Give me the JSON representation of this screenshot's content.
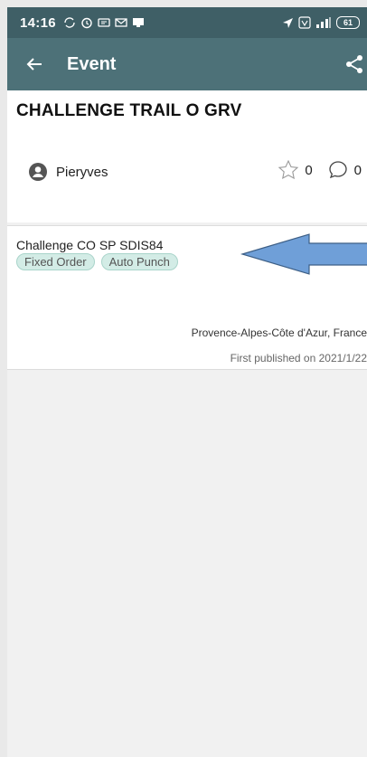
{
  "status": {
    "time": "14:16",
    "battery": "61"
  },
  "appbar": {
    "title": "Event"
  },
  "event": {
    "title": "CHALLENGE TRAIL O GRV",
    "author": "Pieryves",
    "likes": "0",
    "comments": "0"
  },
  "course": {
    "name": "Challenge CO SP SDIS84",
    "tags": [
      "Fixed Order",
      "Auto Punch"
    ]
  },
  "info": {
    "location": "Provence-Alpes-Côte d'Azur, France",
    "published": "First published on 2021/1/22"
  },
  "colors": {
    "statusbar": "#3f5f66",
    "appbar": "#4d7178",
    "tag_bg": "#d3ece6",
    "arrow": "#6f9fd8"
  },
  "icons": [
    "back-arrow-icon",
    "share-icon",
    "user-avatar-icon",
    "star-outline-icon",
    "comment-bubble-icon",
    "alarm-icon",
    "location-arrow-icon",
    "signal-icon"
  ]
}
